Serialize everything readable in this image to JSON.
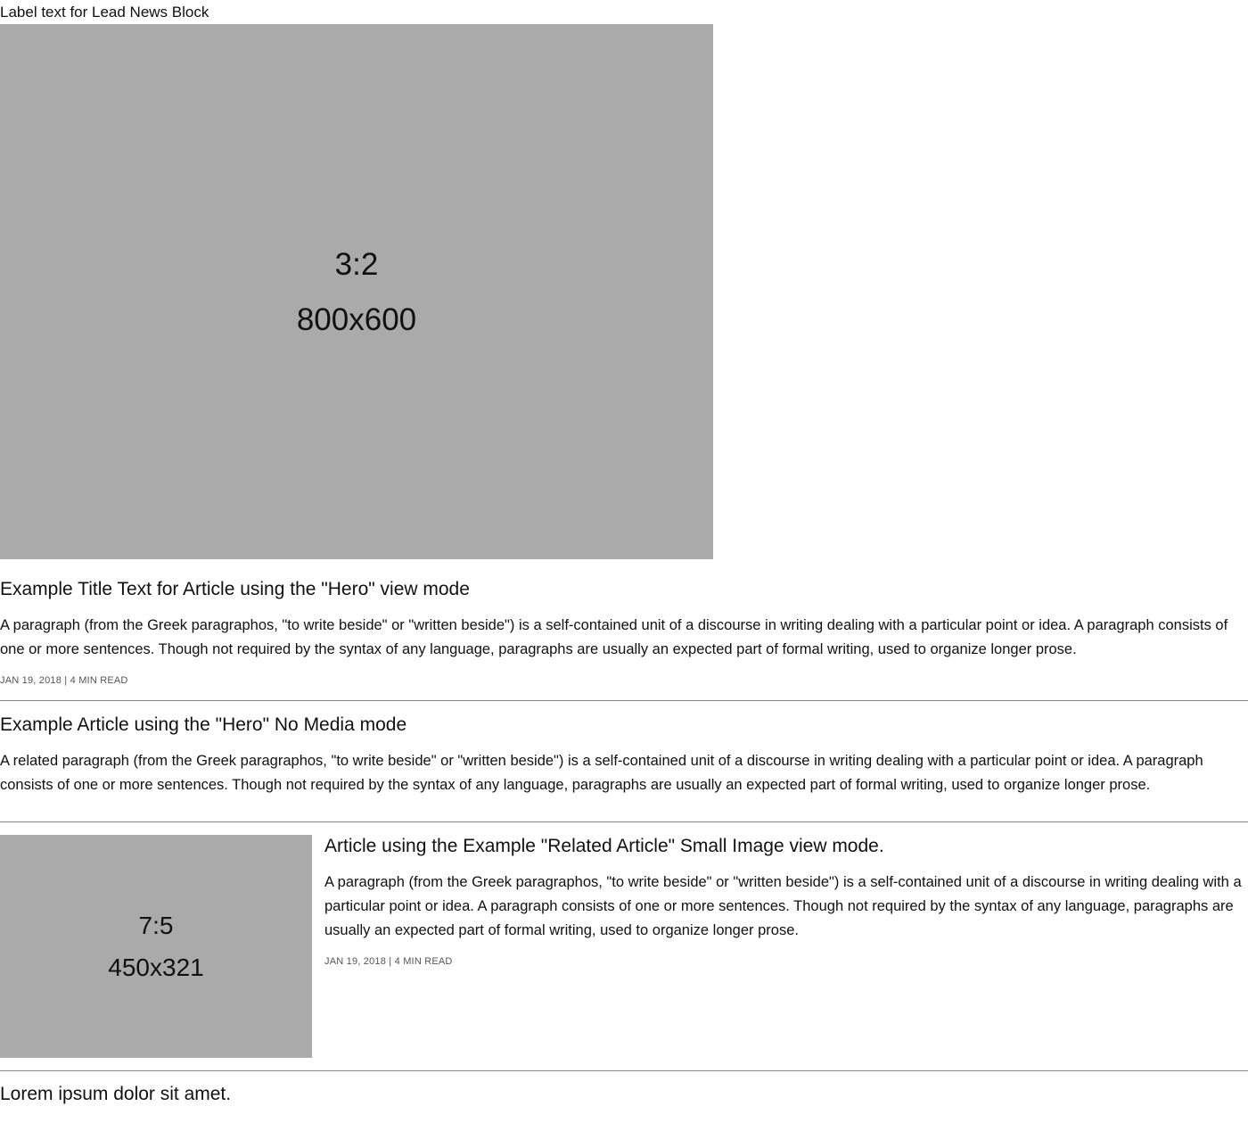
{
  "lead_block": {
    "label": "Label text for Lead News Block"
  },
  "hero": {
    "image_ratio": "3:2",
    "image_dims": "800x600",
    "title": "Example Title Text for Article using the \"Hero\" view mode",
    "body": "A paragraph (from the Greek paragraphos, \"to write beside\" or \"written beside\") is a self-contained unit of a discourse in writing dealing with a particular point or idea. A paragraph consists of one or more sentences. Though not required by the syntax of any language, paragraphs are usually an expected part of formal writing, used to organize longer prose.",
    "meta": "JAN 19, 2018 | 4 MIN READ"
  },
  "hero_no_media": {
    "title": "Example Article using the \"Hero\" No Media mode",
    "body": "A related paragraph (from the Greek paragraphos, \"to write beside\" or \"written beside\") is a self-contained unit of a discourse in writing dealing with a particular point or idea. A paragraph consists of one or more sentences. Though not required by the syntax of any language, paragraphs are usually an expected part of formal writing, used to organize longer prose."
  },
  "related_article": {
    "image_ratio": "7:5",
    "image_dims": "450x321",
    "title": "Article using the Example \"Related Article\" Small Image view mode.",
    "body": "A paragraph (from the Greek paragraphos, \"to write beside\" or \"written beside\") is a self-contained unit of a discourse in writing dealing with a particular point or idea. A paragraph consists of one or more sentences. Though not required by the syntax of any language, paragraphs are usually an expected part of formal writing, used to organize longer prose.",
    "meta": "JAN 19, 2018 | 4 MIN READ"
  },
  "lorem": {
    "title": "Lorem ipsum dolor sit amet."
  },
  "colors": {
    "placeholder_bg": "#aaaaaa",
    "divider": "#888888",
    "meta_text": "#555555"
  }
}
